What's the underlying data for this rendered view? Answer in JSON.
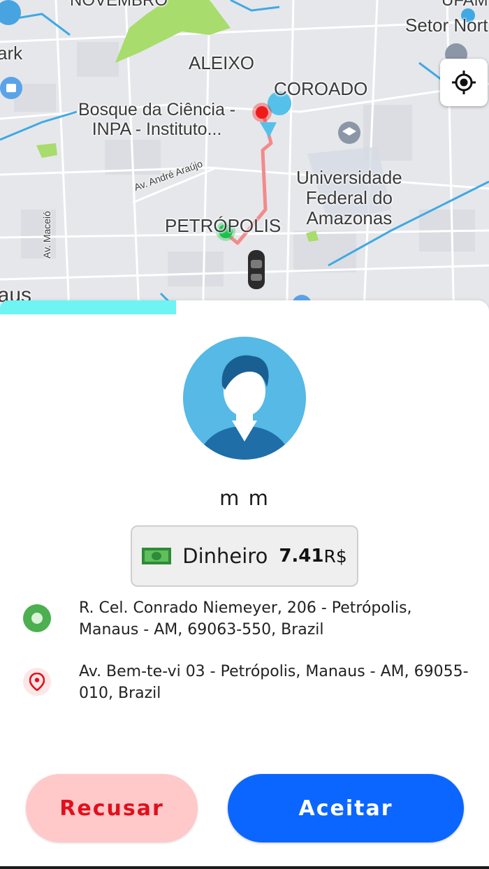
{
  "map": {
    "labels": {
      "novembro": "NOVEMBRO",
      "ufam": "UFAM -",
      "setor": "Setor Nort",
      "ark": "ark",
      "aleixo": "ALEIXO",
      "coroado": "COROADO",
      "bosque": "Bosque da Ciência -\nINPA - Instituto...",
      "universidade": "Universidade\nFederal do\nAmazonas",
      "petropolis": "PETRÓPOLIS",
      "andre_araujo": "Av. André Araújo",
      "maceio": "Av. Maceió",
      "manaus": "naus"
    },
    "colors": {
      "route": "#f28b8b",
      "pickup": "#19c24a",
      "dropoff": "#ef1b1b",
      "park": "#a8dc6c"
    },
    "locate_icon": "my-location-icon"
  },
  "request": {
    "progress": 0.36,
    "progress_color": "#6ef4f3",
    "passenger_name": "m m",
    "payment": {
      "method": "Dinheiro",
      "amount": "7.41",
      "currency": "R$",
      "icon": "cash-icon"
    },
    "origin": {
      "address": "R. Cel. Conrado Niemeyer, 206 - Petrópolis, Manaus - AM, 69063-550, Brazil",
      "icon": "origin-dot-icon"
    },
    "destination": {
      "address": "Av. Bem-te-vi 03 - Petrópolis, Manaus - AM, 69055-010, Brazil",
      "icon": "location-pin-icon"
    }
  },
  "actions": {
    "decline_label": "Recusar",
    "accept_label": "Aceitar",
    "decline_color": "#e0101c",
    "accept_color": "#0b66ff"
  }
}
